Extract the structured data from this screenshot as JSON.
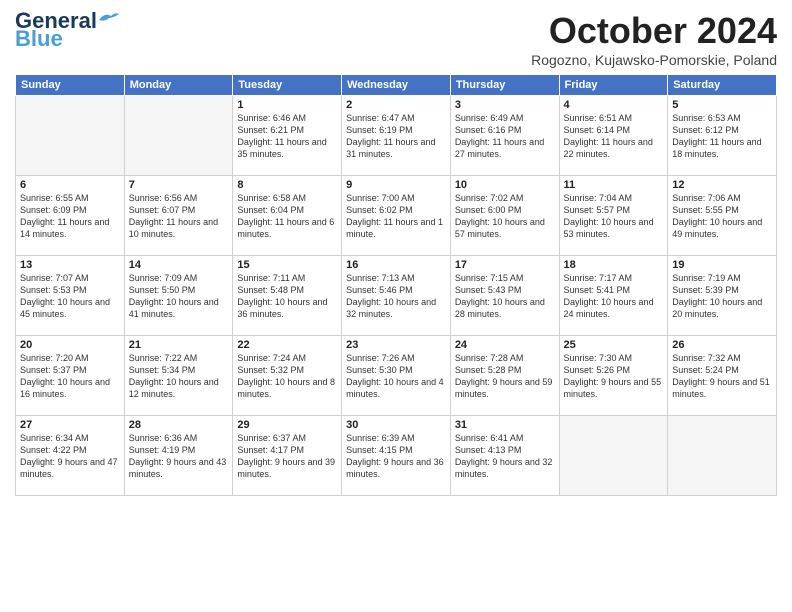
{
  "header": {
    "logo": "GeneralBlue",
    "month": "October 2024",
    "location": "Rogozno, Kujawsko-Pomorskie, Poland"
  },
  "days_of_week": [
    "Sunday",
    "Monday",
    "Tuesday",
    "Wednesday",
    "Thursday",
    "Friday",
    "Saturday"
  ],
  "weeks": [
    [
      {
        "day": "",
        "detail": ""
      },
      {
        "day": "",
        "detail": ""
      },
      {
        "day": "1",
        "detail": "Sunrise: 6:46 AM\nSunset: 6:21 PM\nDaylight: 11 hours\nand 35 minutes."
      },
      {
        "day": "2",
        "detail": "Sunrise: 6:47 AM\nSunset: 6:19 PM\nDaylight: 11 hours\nand 31 minutes."
      },
      {
        "day": "3",
        "detail": "Sunrise: 6:49 AM\nSunset: 6:16 PM\nDaylight: 11 hours\nand 27 minutes."
      },
      {
        "day": "4",
        "detail": "Sunrise: 6:51 AM\nSunset: 6:14 PM\nDaylight: 11 hours\nand 22 minutes."
      },
      {
        "day": "5",
        "detail": "Sunrise: 6:53 AM\nSunset: 6:12 PM\nDaylight: 11 hours\nand 18 minutes."
      }
    ],
    [
      {
        "day": "6",
        "detail": "Sunrise: 6:55 AM\nSunset: 6:09 PM\nDaylight: 11 hours\nand 14 minutes."
      },
      {
        "day": "7",
        "detail": "Sunrise: 6:56 AM\nSunset: 6:07 PM\nDaylight: 11 hours\nand 10 minutes."
      },
      {
        "day": "8",
        "detail": "Sunrise: 6:58 AM\nSunset: 6:04 PM\nDaylight: 11 hours\nand 6 minutes."
      },
      {
        "day": "9",
        "detail": "Sunrise: 7:00 AM\nSunset: 6:02 PM\nDaylight: 11 hours\nand 1 minute."
      },
      {
        "day": "10",
        "detail": "Sunrise: 7:02 AM\nSunset: 6:00 PM\nDaylight: 10 hours\nand 57 minutes."
      },
      {
        "day": "11",
        "detail": "Sunrise: 7:04 AM\nSunset: 5:57 PM\nDaylight: 10 hours\nand 53 minutes."
      },
      {
        "day": "12",
        "detail": "Sunrise: 7:06 AM\nSunset: 5:55 PM\nDaylight: 10 hours\nand 49 minutes."
      }
    ],
    [
      {
        "day": "13",
        "detail": "Sunrise: 7:07 AM\nSunset: 5:53 PM\nDaylight: 10 hours\nand 45 minutes."
      },
      {
        "day": "14",
        "detail": "Sunrise: 7:09 AM\nSunset: 5:50 PM\nDaylight: 10 hours\nand 41 minutes."
      },
      {
        "day": "15",
        "detail": "Sunrise: 7:11 AM\nSunset: 5:48 PM\nDaylight: 10 hours\nand 36 minutes."
      },
      {
        "day": "16",
        "detail": "Sunrise: 7:13 AM\nSunset: 5:46 PM\nDaylight: 10 hours\nand 32 minutes."
      },
      {
        "day": "17",
        "detail": "Sunrise: 7:15 AM\nSunset: 5:43 PM\nDaylight: 10 hours\nand 28 minutes."
      },
      {
        "day": "18",
        "detail": "Sunrise: 7:17 AM\nSunset: 5:41 PM\nDaylight: 10 hours\nand 24 minutes."
      },
      {
        "day": "19",
        "detail": "Sunrise: 7:19 AM\nSunset: 5:39 PM\nDaylight: 10 hours\nand 20 minutes."
      }
    ],
    [
      {
        "day": "20",
        "detail": "Sunrise: 7:20 AM\nSunset: 5:37 PM\nDaylight: 10 hours\nand 16 minutes."
      },
      {
        "day": "21",
        "detail": "Sunrise: 7:22 AM\nSunset: 5:34 PM\nDaylight: 10 hours\nand 12 minutes."
      },
      {
        "day": "22",
        "detail": "Sunrise: 7:24 AM\nSunset: 5:32 PM\nDaylight: 10 hours\nand 8 minutes."
      },
      {
        "day": "23",
        "detail": "Sunrise: 7:26 AM\nSunset: 5:30 PM\nDaylight: 10 hours\nand 4 minutes."
      },
      {
        "day": "24",
        "detail": "Sunrise: 7:28 AM\nSunset: 5:28 PM\nDaylight: 9 hours\nand 59 minutes."
      },
      {
        "day": "25",
        "detail": "Sunrise: 7:30 AM\nSunset: 5:26 PM\nDaylight: 9 hours\nand 55 minutes."
      },
      {
        "day": "26",
        "detail": "Sunrise: 7:32 AM\nSunset: 5:24 PM\nDaylight: 9 hours\nand 51 minutes."
      }
    ],
    [
      {
        "day": "27",
        "detail": "Sunrise: 6:34 AM\nSunset: 4:22 PM\nDaylight: 9 hours\nand 47 minutes."
      },
      {
        "day": "28",
        "detail": "Sunrise: 6:36 AM\nSunset: 4:19 PM\nDaylight: 9 hours\nand 43 minutes."
      },
      {
        "day": "29",
        "detail": "Sunrise: 6:37 AM\nSunset: 4:17 PM\nDaylight: 9 hours\nand 39 minutes."
      },
      {
        "day": "30",
        "detail": "Sunrise: 6:39 AM\nSunset: 4:15 PM\nDaylight: 9 hours\nand 36 minutes."
      },
      {
        "day": "31",
        "detail": "Sunrise: 6:41 AM\nSunset: 4:13 PM\nDaylight: 9 hours\nand 32 minutes."
      },
      {
        "day": "",
        "detail": ""
      },
      {
        "day": "",
        "detail": ""
      }
    ]
  ]
}
